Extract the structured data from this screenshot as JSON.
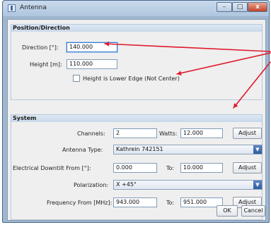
{
  "window": {
    "title": "Antenna",
    "minimize_glyph": "–",
    "maximize_glyph": "□",
    "close_glyph": "x"
  },
  "position": {
    "header": "Position/Direction",
    "direction_label": "Direction [°]:",
    "direction_value": "140.000",
    "height_label": "Height [m]:",
    "height_value": "110.000",
    "lower_edge_label": "Height is Lower Edge (Not Center)",
    "lower_edge_checked": false
  },
  "system": {
    "header": "System",
    "channels_label": "Channels:",
    "channels_value": "2",
    "watts_label": "Watts:",
    "watts_value": "12.000",
    "adjust_label": "Adjust",
    "antenna_type_label": "Antenna Type:",
    "antenna_type_value": "Kathrein 742151",
    "downtilt_label": "Electrical Downtilt From [°]:",
    "downtilt_from": "0.000",
    "to_label": "To:",
    "downtilt_to": "10.000",
    "polarization_label": "Polarization:",
    "polarization_value": "X +45°",
    "frequency_label": "Frequency From [MHz]:",
    "frequency_from": "943.000",
    "frequency_to": "951.000"
  },
  "buttons": {
    "ok": "OK",
    "cancel": "Cancel"
  },
  "colors": {
    "annotation_arrow": "#e0192c"
  }
}
